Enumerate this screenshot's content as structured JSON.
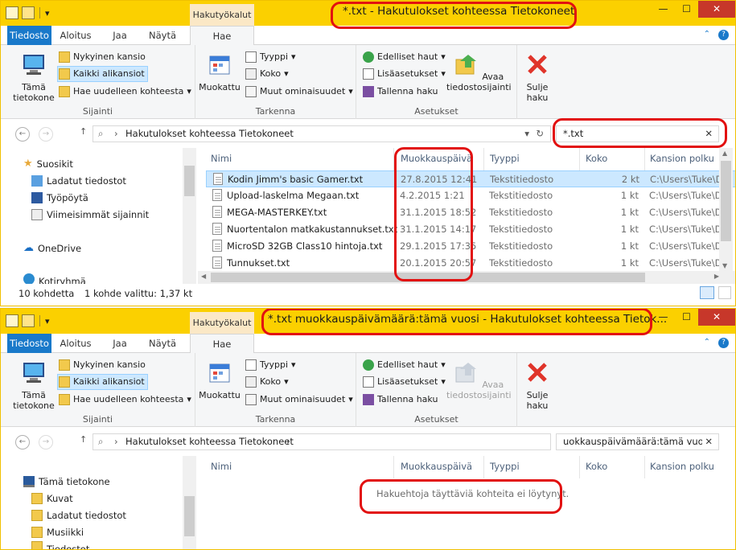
{
  "qat": {
    "down_arrow": "▾"
  },
  "window_controls": {
    "minimize": "—",
    "maximize": "☐",
    "close": "✕"
  },
  "tabs": {
    "file": "Tiedosto",
    "home": "Aloitus",
    "share": "Jaa",
    "view": "Näytä",
    "search": "Hae",
    "context": "Hakutyökalut"
  },
  "ribbon": {
    "location": {
      "this_pc": "Tämä tietokone",
      "current_folder": "Nykyinen kansio",
      "all_subfolders": "Kaikki alikansiot",
      "search_again": "Hae uudelleen kohteesta",
      "group": "Sijainti"
    },
    "refine": {
      "modified": "Muokattu",
      "type": "Tyyppi",
      "size": "Koko",
      "other_props": "Muut ominaisuudet",
      "group": "Tarkenna"
    },
    "options": {
      "recent": "Edelliset haut",
      "advanced": "Lisäasetukset",
      "save": "Tallenna haku",
      "open_location": "Avaa tiedostosijainti",
      "group": "Asetukset"
    },
    "close": {
      "label": "Sulje haku"
    }
  },
  "address": {
    "path": "Hakutulokset kohteessa Tietokoneet"
  },
  "columns": {
    "name": "Nimi",
    "modified": "Muokkauspäivä",
    "type": "Tyyppi",
    "size": "Koko",
    "path": "Kansion polku"
  },
  "windows": [
    {
      "title": "*.txt - Hakutulokset kohteessa Tietokoneet",
      "search": "*.txt",
      "nav": [
        {
          "label": "Suosikit",
          "icon": "star-icon"
        },
        {
          "label": "Ladatut tiedostot",
          "icon": "downloads-icon"
        },
        {
          "label": "Työpöytä",
          "icon": "desktop-icon"
        },
        {
          "label": "Viimeisimmät sijainnit",
          "icon": "recent-places-icon"
        },
        {
          "label": "OneDrive",
          "icon": "cloud-icon"
        },
        {
          "label": "Kotiryhmä",
          "icon": "homegroup-icon"
        }
      ],
      "rows": [
        {
          "name": "Kodin Jimm's basic Gamer.txt",
          "modified": "27.8.2015 12:41",
          "type": "Tekstitiedosto",
          "size": "2 kt",
          "path": "C:\\Users\\Tuke\\D"
        },
        {
          "name": "Upload-laskelma Megaan.txt",
          "modified": "4.2.2015 1:21",
          "type": "Tekstitiedosto",
          "size": "1 kt",
          "path": "C:\\Users\\Tuke\\D"
        },
        {
          "name": "MEGA-MASTERKEY.txt",
          "modified": "31.1.2015 18:52",
          "type": "Tekstitiedosto",
          "size": "1 kt",
          "path": "C:\\Users\\Tuke\\D"
        },
        {
          "name": "Nuortentalon matkakustannukset.txt",
          "modified": "31.1.2015 14:17",
          "type": "Tekstitiedosto",
          "size": "1 kt",
          "path": "C:\\Users\\Tuke\\D"
        },
        {
          "name": "MicroSD 32GB Class10 hintoja.txt",
          "modified": "29.1.2015 17:35",
          "type": "Tekstitiedosto",
          "size": "1 kt",
          "path": "C:\\Users\\Tuke\\D"
        },
        {
          "name": "Tunnukset.txt",
          "modified": "20.1.2015 20:57",
          "type": "Tekstitiedosto",
          "size": "1 kt",
          "path": "C:\\Users\\Tuke\\D"
        }
      ],
      "status": {
        "count": "10 kohdetta",
        "selected": "1 kohde valittu: 1,37 kt"
      }
    },
    {
      "title": "*.txt muokkauspäivämäärä:tämä vuosi - Hakutulokset kohteessa Tietok...",
      "search": "uokkauspäivämäärä:tämä vuosi",
      "nav": [
        {
          "label": "Tämä tietokone",
          "icon": "computer-icon"
        },
        {
          "label": "Kuvat",
          "icon": "folder-icon"
        },
        {
          "label": "Ladatut tiedostot",
          "icon": "downloads-icon"
        },
        {
          "label": "Musiikki",
          "icon": "music-folder-icon"
        },
        {
          "label": "Tiedostot",
          "icon": "documents-icon"
        }
      ],
      "empty_message": "Hakuehtoja täyttäviä kohteita ei löytynyt."
    }
  ]
}
